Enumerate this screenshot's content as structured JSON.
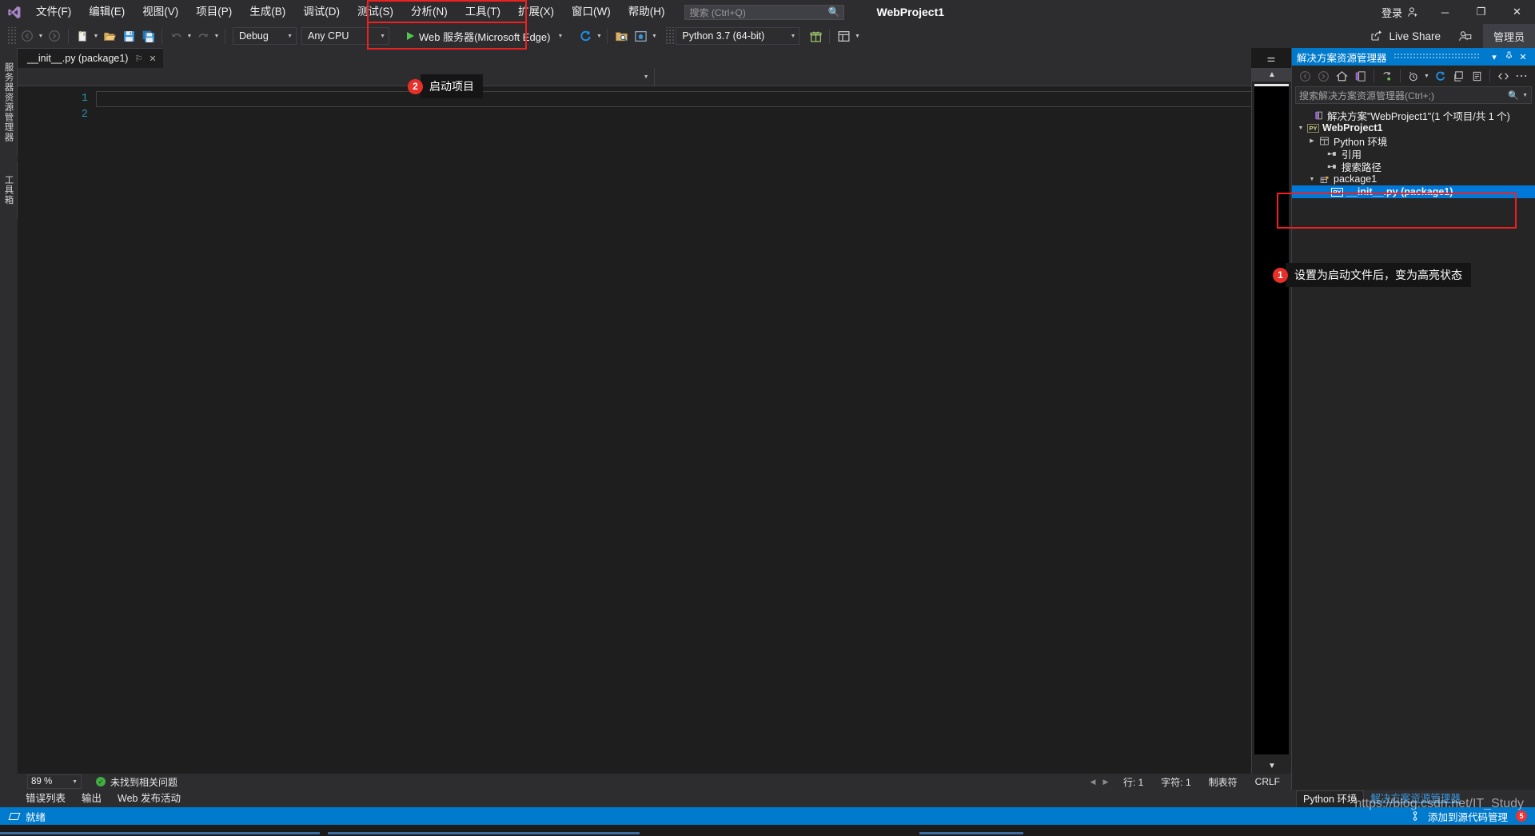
{
  "titlebar": {
    "project_title": "WebProject1",
    "menu": [
      {
        "label": "文件(F)"
      },
      {
        "label": "编辑(E)"
      },
      {
        "label": "视图(V)"
      },
      {
        "label": "项目(P)"
      },
      {
        "label": "生成(B)"
      },
      {
        "label": "调试(D)"
      },
      {
        "label": "测试(S)"
      },
      {
        "label": "分析(N)"
      },
      {
        "label": "工具(T)"
      },
      {
        "label": "扩展(X)"
      },
      {
        "label": "窗口(W)"
      },
      {
        "label": "帮助(H)"
      }
    ],
    "quick_search_placeholder": "搜索 (Ctrl+Q)",
    "sign_in": "登录",
    "minimize": "─",
    "maximize": "❐",
    "close": "✕"
  },
  "toolbar": {
    "config": "Debug",
    "platform": "Any CPU",
    "start_label": "Web 服务器(Microsoft Edge)",
    "interpreter": "Python 3.7 (64-bit)",
    "live_share": "Live Share",
    "admin": "管理员"
  },
  "left_dock": {
    "tabs": [
      "服务器资源管理器",
      "工具箱"
    ]
  },
  "editor": {
    "tab_title": "__init__.py (package1)",
    "pin_glyph": "⚐",
    "close_glyph": "✕",
    "nav_left": "",
    "nav_right": "",
    "line_numbers": [
      "1",
      "2"
    ],
    "lines": [
      "",
      ""
    ],
    "zoom": "89 %",
    "issues": "未找到相关问题",
    "caret_line": "行: 1",
    "caret_col": "字符: 1",
    "tabs_mode": "制表符",
    "eol": "CRLF"
  },
  "output_tabs": [
    "错误列表",
    "输出",
    "Web 发布活动"
  ],
  "solution_explorer": {
    "title": "解决方案资源管理器",
    "search_placeholder": "搜索解决方案资源管理器(Ctrl+;)",
    "header_buttons": {
      "dropdown": "▾",
      "pin": "中",
      "close": "✕"
    },
    "tree": [
      {
        "indent": 0,
        "expander": "",
        "icon": "solution-icon",
        "label": "解决方案\"WebProject1\"(1 个项目/共 1 个)",
        "bold": false,
        "selected": false
      },
      {
        "indent": 1,
        "expander": "▼",
        "icon": "python-project-icon",
        "label": "WebProject1",
        "bold": true,
        "selected": false
      },
      {
        "indent": 2,
        "expander": "▶",
        "icon": "env-icon",
        "label": "Python 环境",
        "bold": false,
        "selected": false
      },
      {
        "indent": 3,
        "expander": "",
        "icon": "references-icon",
        "label": "引用",
        "bold": false,
        "selected": false
      },
      {
        "indent": 3,
        "expander": "",
        "icon": "references-icon",
        "label": "搜索路径",
        "bold": false,
        "selected": false
      },
      {
        "indent": 2,
        "expander": "▼",
        "icon": "package-icon",
        "label": "package1",
        "bold": false,
        "selected": false
      },
      {
        "indent": 3,
        "expander": "",
        "icon": "python-file-icon",
        "label": "__init__.py (package1)",
        "bold": true,
        "selected": true
      }
    ]
  },
  "bottom_dock_tabs": [
    {
      "label": "Python 环境",
      "active": true
    },
    {
      "label": "解决方案资源管理器",
      "active": false
    }
  ],
  "statusbar": {
    "ready": "就绪",
    "source_control": "添加到源代码管理",
    "badge": "5",
    "watermark": "https://blog.csdn.net/IT_Study"
  },
  "annotations": [
    {
      "num": "1",
      "text": "设置为启动文件后，变为高亮状态"
    },
    {
      "num": "2",
      "text": "启动项目"
    }
  ],
  "colors": {
    "accent": "#007acc",
    "selection": "#0078d7",
    "annotation_red": "#e8302a",
    "chrome": "#2d2d30",
    "editor_bg": "#1e1e1e"
  }
}
